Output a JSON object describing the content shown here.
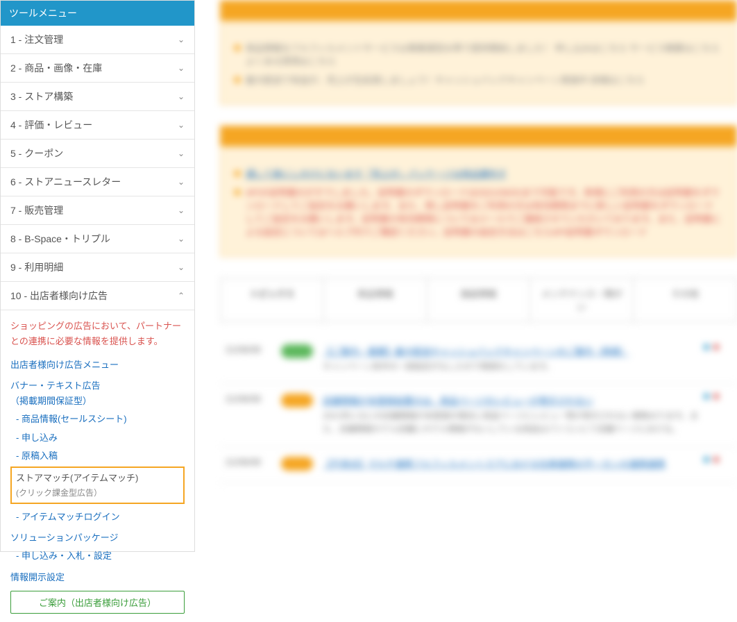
{
  "sidebar": {
    "title": "ツールメニュー",
    "items": [
      {
        "label": "1 - 注文管理",
        "expanded": false
      },
      {
        "label": "2 - 商品・画像・在庫",
        "expanded": false
      },
      {
        "label": "3 - ストア構築",
        "expanded": false
      },
      {
        "label": "4 - 評価・レビュー",
        "expanded": false
      },
      {
        "label": "5 - クーポン",
        "expanded": false
      },
      {
        "label": "6 - ストアニュースレター",
        "expanded": false
      },
      {
        "label": "7 - 販売管理",
        "expanded": false
      },
      {
        "label": "8 - B-Space・トリプル",
        "expanded": false
      },
      {
        "label": "9 - 利用明細",
        "expanded": false
      },
      {
        "label": "10 - 出店者様向け広告",
        "expanded": true
      }
    ],
    "notice": "ショッピングの広告において、パートナーとの連携に必要な情報を提供します。",
    "ad_menu_header": "出店者様向け広告メニュー",
    "banner_text": {
      "title": "バナー・テキスト広告",
      "subtitle": "（掲載期間保証型）",
      "links": [
        "- 商品情報(セールスシート)",
        "- 申し込み",
        "- 原稿入稿"
      ]
    },
    "store_match": {
      "title": "ストアマッチ(アイテムマッチ)",
      "subtitle": "(クリック課金型広告）",
      "link": "- アイテムマッチログイン"
    },
    "solution": {
      "title": "ソリューションパッケージ",
      "link": "- 申し込み・入札・設定"
    },
    "disclosure": "情報開示設定",
    "green_button": "ご案内（出店者様向け広告）"
  },
  "main": {
    "box1_lines": [
      "商品情報なフルフィルメントサービスは事業運営水準で提供開始しました！  申し込みはこちら サービス概要はこちら よくある質問はこちら",
      "最大配送で有益が、売上が生拡張しましょう！キャッシュバックキャンペーン実施中 詳細はこちら"
    ],
    "box2_lines": [
      "通して楽にしのけにないます「売上が」パッケージは商品要約す",
      "APIの証明書のがすでしました。証明書のダウンロードは2021/06/02まで可能です。新規にご利用の方は証明書をダウンロードしてご設定をお願いします。また、再し証明書をご利用の方は有効期限までに新しい証明書をダウンロードしてご設定をお願いします。証明書の有効期限についてはメールでご連絡させていただいております。また、証明書による設定についてはヘルプ内でご確認ください。証明書の設定方法はこちらAPI証明書ダウンロード"
    ],
    "tabs": [
      "トピックス",
      "商品情報",
      "施設情報",
      "メンテナンス・障がい",
      "その他"
    ],
    "rows": [
      {
        "date": "21/06/08",
        "tag": "green",
        "title": "【ご案内・重要】最大配送キャッシュバックキャンペーンのご案内（再掲）",
        "sub": "キャンペーン条件の一部設定がなしたので再掲をしています。"
      },
      {
        "date": "21/06/08",
        "tag": "orange",
        "title": "店舗情報が未登録設置のは、商品ページのレビューが表示されない",
        "sub": "2021年になにの店舗情報が未登録の場合に商品ページにレビュー等が表示されない事象おります。また、店舗情報ホテル店舗にホテル情報がないしている商品はパソコンにて店舗ページにおける。"
      },
      {
        "date": "21/06/08",
        "tag": "orange",
        "title": "【不具合】マルチ連携フルフィルメントスアにおける在庫連携の不一カンの連携連携",
        "sub": ""
      }
    ]
  }
}
